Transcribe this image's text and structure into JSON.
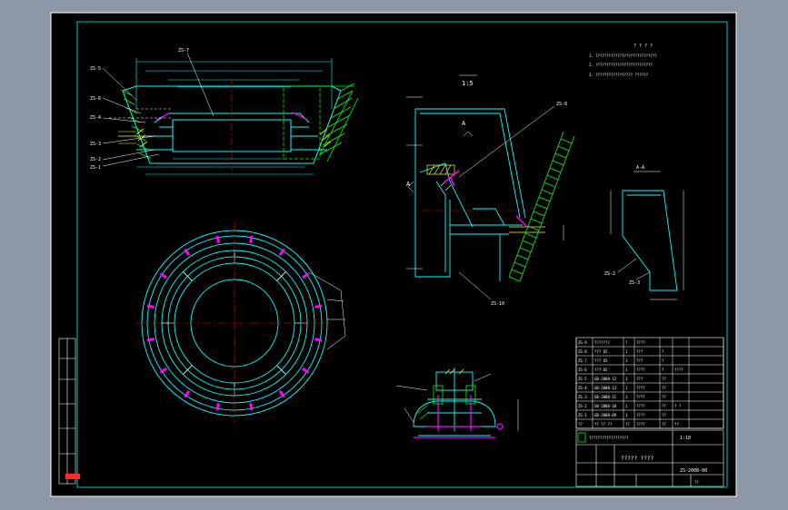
{
  "drawing": {
    "colors": {
      "app_bg": "#8d97a6",
      "paper": "#000000",
      "frame": "#ffffff",
      "border": "#00b0b0",
      "cyan": "#00ffff",
      "green": "#00ff00",
      "red": "#ff0000",
      "magenta": "#ff00ff",
      "yellow": "#ffff00",
      "white": "#ffffff",
      "orange": "#ff8000"
    },
    "top_view": {
      "callouts_left": [
        "ZS-5",
        "ZS-6",
        "ZS-4",
        "ZS-3",
        "ZS-2",
        "ZS-1"
      ],
      "callout_top": "ZS-7"
    },
    "detail_view": {
      "scale_label": "1:5",
      "callout_top": "ZS-8",
      "callout_bottom": "ZS-10",
      "section_mark": "A"
    },
    "section_view": {
      "label": "A-A",
      "callouts": [
        "ZS-2",
        "ZS-3"
      ]
    },
    "notes": {
      "heading": "? ? ? ?",
      "lines": [
        "1. ????????????????????????????",
        "2. ??????????????????????????",
        "3. ?????????????????     ??????"
      ]
    },
    "bom": {
      "rows": [
        [
          "ZS-9",
          "???????",
          "?",
          "????",
          "",
          ""
        ],
        [
          "ZS-8",
          "??? 65",
          "1",
          "???",
          "?",
          ""
        ],
        [
          "ZS-7",
          "??? 65",
          "1",
          "???",
          "?",
          ""
        ],
        [
          "ZS-6",
          "??? 65",
          "1",
          "????",
          "?",
          "????"
        ],
        [
          "ZS-5",
          "GB-2008-12",
          "1",
          "???",
          "??",
          ""
        ],
        [
          "ZS-4",
          "GB-2008-13",
          "1",
          "????",
          "??",
          ""
        ],
        [
          "ZS-3",
          "GB-2008-11",
          "1",
          "????",
          "??",
          ""
        ],
        [
          "ZS-2",
          "GB-2008-10",
          "1",
          "????",
          "??",
          "? ?"
        ],
        [
          "ZS-1",
          "GB-2008-09",
          "1",
          "????",
          "??",
          ""
        ]
      ],
      "header": [
        "??",
        "?? ?? ??",
        "??",
        "????",
        "??",
        "??"
      ]
    },
    "title_block": {
      "company": "??????????????????",
      "drawing_name": "?????\n????",
      "drawing_no": "ZS-2008-00",
      "scale": "1:10",
      "sheet": "??"
    }
  }
}
